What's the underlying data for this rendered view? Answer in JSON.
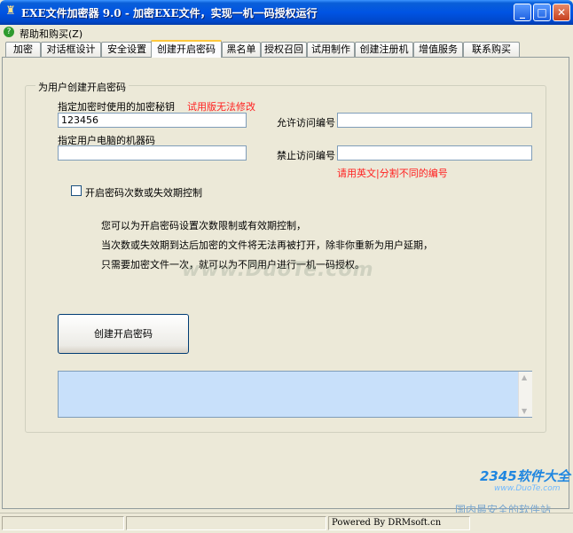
{
  "window": {
    "title": "EXE文件加密器 9.0 - 加密EXE文件，实现一机一码授权运行"
  },
  "menu": {
    "help": "帮助和购买(Z)"
  },
  "tabs": [
    "加密",
    "对话框设计",
    "安全设置",
    "创建开启密码",
    "黑名单",
    "授权召回",
    "试用制作",
    "创建注册机",
    "增值服务",
    "联系购买"
  ],
  "form": {
    "group_title": "为用户创建开启密码",
    "key_label": "指定加密时使用的加密秘钥",
    "trial_note": "试用版无法修改",
    "key_value": "123456",
    "machine_label": "指定用户电脑的机器码",
    "machine_value": "",
    "allow_label": "允许访问编号",
    "allow_value": "",
    "deny_label": "禁止访问编号",
    "deny_value": "",
    "separator_note": "请用英文|分割不同的编号",
    "checkbox_label": "开启密码次数或失效期控制",
    "info_line1": "您可以为开启密码设置次数限制或有效期控制，",
    "info_line2": "当次数或失效期到达后加密的文件将无法再被打开，除非你重新为用户延期，",
    "info_line3": "只需要加密文件一次，就可以为不同用户进行一机一码授权。",
    "create_button": "创建开启密码",
    "output_value": ""
  },
  "status": {
    "cell3": "Powered By DRMsoft.cn"
  },
  "watermark": {
    "text": "www.DuoTe.com"
  },
  "corner_logo": {
    "brand": "2345软件大全",
    "url": "www.DuoTe.com",
    "slogan": "国内最安全的软件站"
  }
}
